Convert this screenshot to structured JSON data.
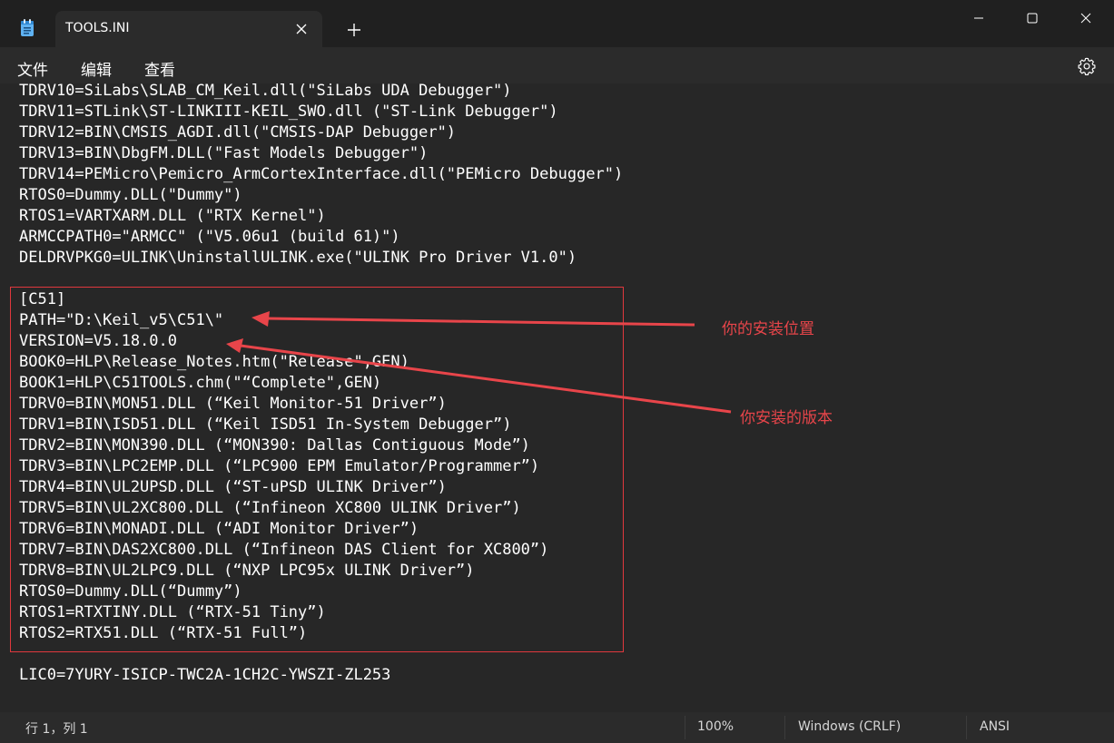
{
  "window": {
    "tab_title": "TOOLS.INI",
    "new_tab_symbol": "+"
  },
  "menu": {
    "file": "文件",
    "edit": "编辑",
    "view": "查看"
  },
  "editor": {
    "lines": [
      "TDRV10=SiLabs\\SLAB_CM_Keil.dll(\"SiLabs UDA Debugger\")",
      "TDRV11=STLink\\ST-LINKIII-KEIL_SWO.dll (\"ST-Link Debugger\")",
      "TDRV12=BIN\\CMSIS_AGDI.dll(\"CMSIS-DAP Debugger\")",
      "TDRV13=BIN\\DbgFM.DLL(\"Fast Models Debugger\")",
      "TDRV14=PEMicro\\Pemicro_ArmCortexInterface.dll(\"PEMicro Debugger\")",
      "RTOS0=Dummy.DLL(\"Dummy\")",
      "RTOS1=VARTXARM.DLL (\"RTX Kernel\")",
      "ARMCCPATH0=\"ARMCC\" (\"V5.06u1 (build 61)\")",
      "DELDRVPKG0=ULINK\\UninstallULINK.exe(\"ULINK Pro Driver V1.0\")",
      "",
      "[C51]",
      "PATH=\"D:\\Keil_v5\\C51\\\"",
      "VERSION=V5.18.0.0",
      "BOOK0=HLP\\Release_Notes.htm(\"Release\",GEN)",
      "BOOK1=HLP\\C51TOOLS.chm(\"“Complete\",GEN)",
      "TDRV0=BIN\\MON51.DLL (“Keil Monitor-51 Driver”)",
      "TDRV1=BIN\\ISD51.DLL (“Keil ISD51 In-System Debugger”)",
      "TDRV2=BIN\\MON390.DLL (“MON390: Dallas Contiguous Mode”)",
      "TDRV3=BIN\\LPC2EMP.DLL (“LPC900 EPM Emulator/Programmer”)",
      "TDRV4=BIN\\UL2UPSD.DLL (“ST-uPSD ULINK Driver”)",
      "TDRV5=BIN\\UL2XC800.DLL (“Infineon XC800 ULINK Driver”)",
      "TDRV6=BIN\\MONADI.DLL (“ADI Monitor Driver”)",
      "TDRV7=BIN\\DAS2XC800.DLL (“Infineon DAS Client for XC800”)",
      "TDRV8=BIN\\UL2LPC9.DLL (“NXP LPC95x ULINK Driver”)",
      "RTOS0=Dummy.DLL(“Dummy”)",
      "RTOS1=RTXTINY.DLL (“RTX-51 Tiny”)",
      "RTOS2=RTX51.DLL (“RTX-51 Full”)",
      "",
      "LIC0=7YURY-ISICP-TWC2A-1CH2C-YWSZI-ZL253"
    ]
  },
  "annotations": {
    "install_location": "你的安装位置",
    "installed_version": "你安装的版本",
    "color": "#e8454a"
  },
  "status": {
    "position": "行 1，列 1",
    "zoom": "100%",
    "line_ending": "Windows (CRLF)",
    "encoding": "ANSI"
  }
}
